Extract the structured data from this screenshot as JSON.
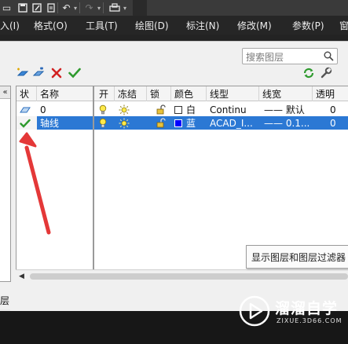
{
  "menubar": {
    "items": [
      "入(I)",
      "格式(O)",
      "工具(T)",
      "绘图(D)",
      "标注(N)",
      "修改(M)",
      "参数(P)",
      "窗"
    ]
  },
  "search": {
    "placeholder": "搜索图层"
  },
  "columns": [
    "状",
    "名称",
    "开",
    "冻结",
    "锁",
    "颜色",
    "线型",
    "线宽",
    "透明"
  ],
  "layers": [
    {
      "status_icon": "layer-parallelogram-icon",
      "name": "0",
      "on_icon": "lightbulb-icon",
      "freeze_icon": "sun-icon",
      "lock_icon": "unlock-icon",
      "color_name": "白",
      "color_hex": "#ffffff",
      "linetype": "Continu",
      "lineweight": "—— 默认",
      "transparency": "0",
      "selected": false
    },
    {
      "status_icon": "check-icon",
      "name": "轴线",
      "on_icon": "lightbulb-icon",
      "freeze_icon": "sun-icon",
      "lock_icon": "unlock-icon",
      "color_name": "蓝",
      "color_hex": "#0000ff",
      "linetype": "ACAD_I...",
      "lineweight": "—— 0.1...",
      "transparency": "0",
      "selected": true
    }
  ],
  "tooltip": {
    "text": "显示图层和图层过滤器"
  },
  "status_bar": {
    "text": "层"
  },
  "left_panel": {
    "collapse_glyph": "«"
  },
  "watermark": {
    "title": "溜溜自学",
    "subtitle": "ZIXUE.3D66.COM"
  },
  "colors": {
    "selection": "#2b78d4",
    "accent_green": "#2e9a2e",
    "delete_red": "#d22222",
    "annotation_arrow": "#e43838"
  }
}
